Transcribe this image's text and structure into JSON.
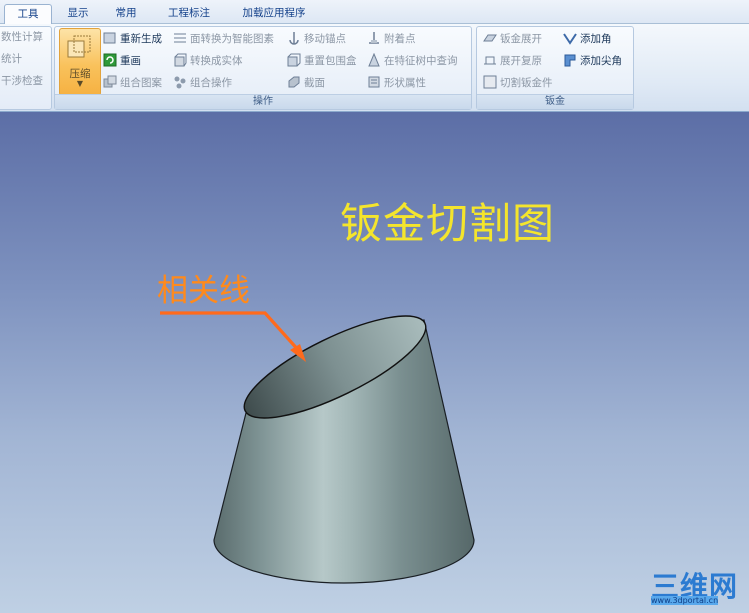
{
  "tabs": [
    {
      "label": "工具",
      "active": true
    },
    {
      "label": "显示",
      "active": false
    },
    {
      "label": "常用",
      "active": false
    },
    {
      "label": "工程标注",
      "active": false
    },
    {
      "label": "加载应用程序",
      "active": false
    }
  ],
  "group_left": {
    "items": [
      "数性计算",
      "统计",
      "干涉检查"
    ]
  },
  "group_ops": {
    "label": "操作",
    "big_button": "压缩",
    "col1": [
      "重新生成",
      "重画",
      "组合图案"
    ],
    "col2": [
      "面转换为智能图素",
      "转换成实体",
      "组合操作"
    ],
    "col3": [
      "移动锚点",
      "重置包围盒",
      "截面"
    ],
    "col4": [
      "附着点",
      "在特征树中查询",
      "形状属性"
    ]
  },
  "group_sheet": {
    "label": "钣金",
    "col1": [
      "钣金展开",
      "展开复原",
      "切割钣金件"
    ],
    "col2": [
      "添加角",
      "添加尖角"
    ]
  },
  "viewport": {
    "title": "钣金切割图",
    "annotation": "相关线"
  },
  "watermark": {
    "brand": "三维网",
    "url": "www.3dportal.cn"
  },
  "colors": {
    "title": "#f4e52c",
    "annotation": "#ff8a1c",
    "arrow": "#ff6a1c",
    "solid": "#8ea4a6"
  }
}
